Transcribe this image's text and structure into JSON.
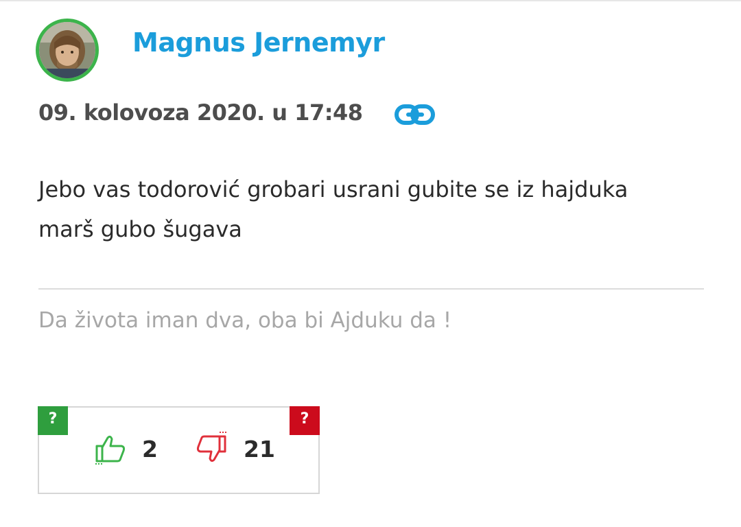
{
  "comment": {
    "author": "Magnus Jernemyr",
    "date": "09. kolovoza 2020. u 17:48",
    "text_lines": [
      "Jebo vas todorović grobari usrani gubite se iz hajduka",
      "marš gubo šugava"
    ],
    "signature": "Da života iman dva, oba bi Ajduku da !"
  },
  "votes": {
    "like_help": "?",
    "dislike_help": "?",
    "likes": "2",
    "dislikes": "21"
  },
  "icons": {
    "link": "link-icon",
    "thumbs_up": "thumbs-up-icon",
    "thumbs_down": "thumbs-down-icon"
  },
  "colors": {
    "author": "#1b9ddb",
    "avatar_ring": "#3cb44b",
    "like": "#3cb44b",
    "dislike": "#e0303b",
    "like_help_bg": "#2f9e3e",
    "dislike_help_bg": "#cc0b1c"
  }
}
